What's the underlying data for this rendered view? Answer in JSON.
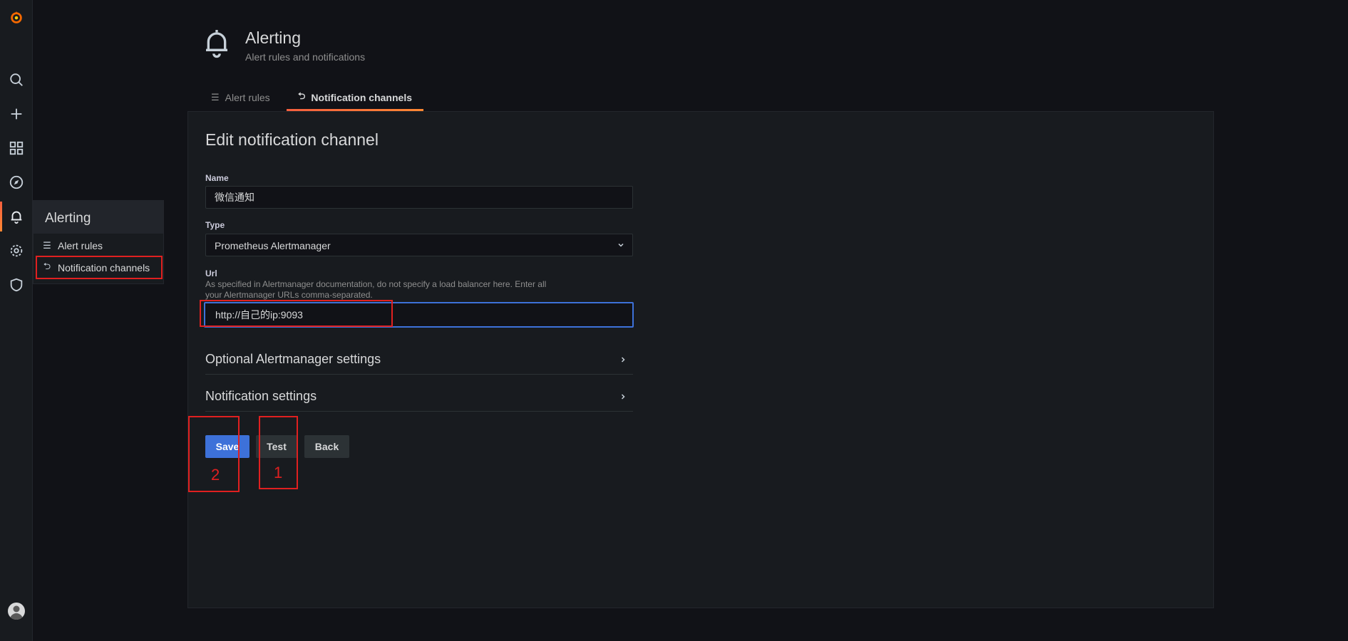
{
  "colors": {
    "accent": "#f55f3e",
    "primary_button": "#3d71d9",
    "focus_border": "#3d71d9",
    "annotation": "#e02020"
  },
  "sidenav": {
    "items": [
      {
        "icon": "grafana-logo-icon"
      },
      {
        "icon": "search-icon"
      },
      {
        "icon": "plus-icon"
      },
      {
        "icon": "dashboards-icon"
      },
      {
        "icon": "explore-icon"
      },
      {
        "icon": "bell-icon",
        "active": true
      },
      {
        "icon": "gear-icon"
      },
      {
        "icon": "shield-icon"
      }
    ]
  },
  "submenu": {
    "title": "Alerting",
    "items": [
      {
        "label": "Alert rules"
      },
      {
        "label": "Notification channels",
        "active": true
      }
    ]
  },
  "header": {
    "title": "Alerting",
    "subtitle": "Alert rules and notifications"
  },
  "tabs": [
    {
      "label": "Alert rules"
    },
    {
      "label": "Notification channels",
      "active": true
    }
  ],
  "form": {
    "title": "Edit notification channel",
    "name": {
      "label": "Name",
      "value": "微信通知"
    },
    "type": {
      "label": "Type",
      "value": "Prometheus Alertmanager"
    },
    "url": {
      "label": "Url",
      "description": "As specified in Alertmanager documentation, do not specify a load balancer here. Enter all your Alertmanager URLs comma-separated.",
      "value": "http://自己的ip:9093"
    },
    "sections": [
      {
        "label": "Optional Alertmanager settings"
      },
      {
        "label": "Notification settings"
      }
    ],
    "buttons": {
      "save": "Save",
      "test": "Test",
      "back": "Back"
    }
  },
  "annotations": {
    "label_1": "1",
    "label_2": "2"
  }
}
